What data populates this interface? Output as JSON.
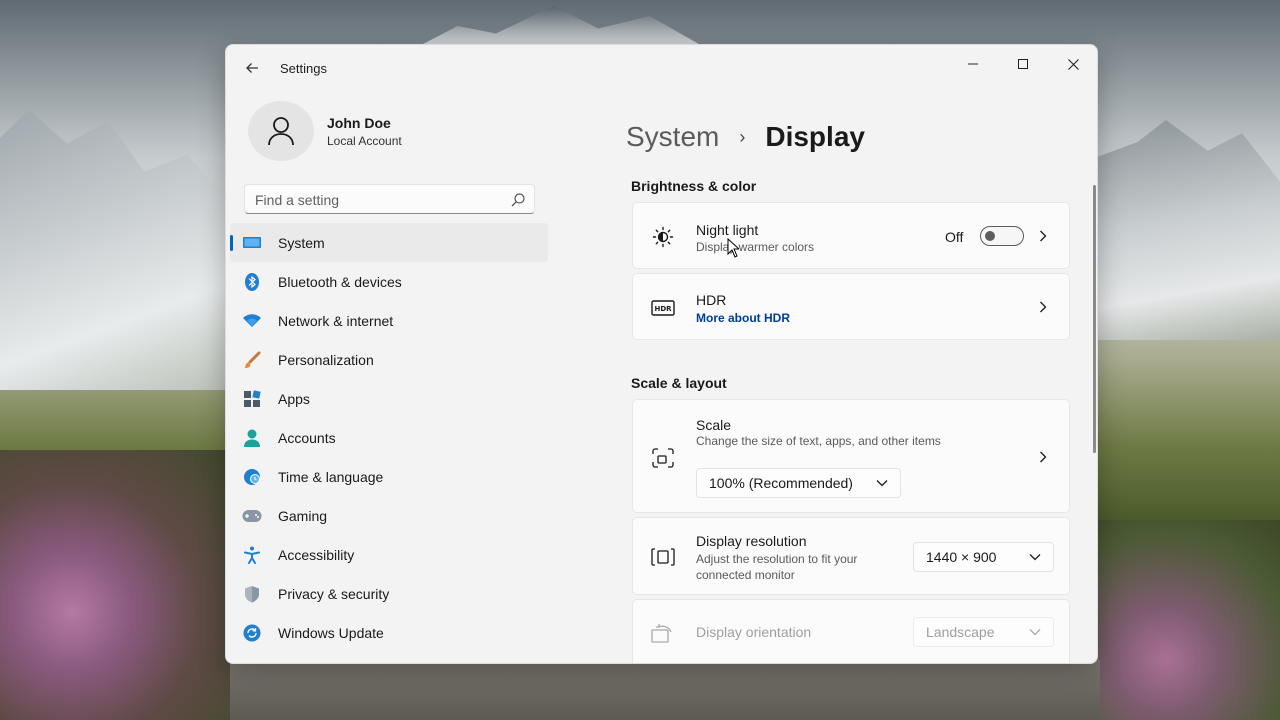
{
  "window": {
    "title": "Settings"
  },
  "profile": {
    "name": "John Doe",
    "account_type": "Local Account"
  },
  "search": {
    "placeholder": "Find a setting"
  },
  "nav": {
    "items": [
      {
        "label": "System",
        "icon": "system-icon",
        "active": true
      },
      {
        "label": "Bluetooth & devices",
        "icon": "bluetooth-icon"
      },
      {
        "label": "Network & internet",
        "icon": "wifi-icon"
      },
      {
        "label": "Personalization",
        "icon": "brush-icon"
      },
      {
        "label": "Apps",
        "icon": "apps-icon"
      },
      {
        "label": "Accounts",
        "icon": "accounts-icon"
      },
      {
        "label": "Time & language",
        "icon": "globe-clock-icon"
      },
      {
        "label": "Gaming",
        "icon": "gamepad-icon"
      },
      {
        "label": "Accessibility",
        "icon": "accessibility-icon"
      },
      {
        "label": "Privacy & security",
        "icon": "shield-icon"
      },
      {
        "label": "Windows Update",
        "icon": "update-icon"
      }
    ]
  },
  "breadcrumb": {
    "parent": "System",
    "separator": "›",
    "current": "Display"
  },
  "sections": {
    "brightness": {
      "title": "Brightness & color",
      "night_light": {
        "title": "Night light",
        "subtitle": "Display warmer colors",
        "state_label": "Off",
        "enabled": false
      },
      "hdr": {
        "title": "HDR",
        "link": "More about HDR"
      }
    },
    "scale_layout": {
      "title": "Scale & layout",
      "scale": {
        "title": "Scale",
        "subtitle": "Change the size of text, apps, and other items",
        "value": "100% (Recommended)"
      },
      "resolution": {
        "title": "Display resolution",
        "subtitle_line1": "Adjust the resolution to fit your",
        "subtitle_line2": "connected monitor",
        "value": "1440 × 900"
      },
      "orientation": {
        "title": "Display orientation",
        "value": "Landscape",
        "disabled": true
      }
    }
  },
  "colors": {
    "accent": "#0067c0",
    "link": "#003e92",
    "window_bg": "#f3f3f3",
    "card_bg": "#fbfbfb"
  }
}
